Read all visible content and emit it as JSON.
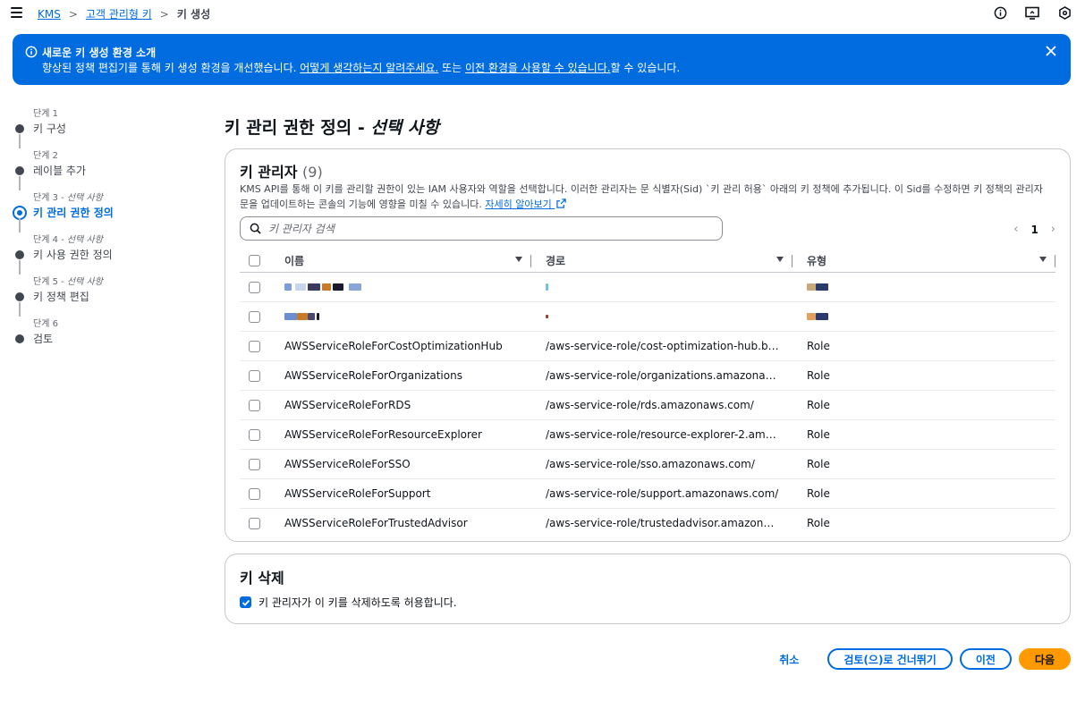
{
  "breadcrumb": {
    "items": [
      "KMS",
      "고객 관리형 키"
    ],
    "current": "키 생성"
  },
  "flash": {
    "title": "새로운 키 생성 환경 소개",
    "body_prefix": "향상된 정책 편집기를 통해 키 생성 환경을 개선했습니다. ",
    "link1": "어떻게 생각하는지 알려주세요.",
    "middle": " 또는 ",
    "link2": "이전 환경을 사용할 수 있습니다.",
    "suffix": "할 수 있습니다."
  },
  "steps": [
    {
      "small": "단계 1",
      "optional": "",
      "label": "키 구성",
      "active": false
    },
    {
      "small": "단계 2",
      "optional": "",
      "label": "레이블 추가",
      "active": false
    },
    {
      "small": "단계 3 - ",
      "optional": "선택 사항",
      "label": "키 관리 권한 정의",
      "active": true
    },
    {
      "small": "단계 4 - ",
      "optional": "선택 사항",
      "label": "키 사용 권한 정의",
      "active": false
    },
    {
      "small": "단계 5 - ",
      "optional": "선택 사항",
      "label": "키 정책 편집",
      "active": false
    },
    {
      "small": "단계 6",
      "optional": "",
      "label": "검토",
      "active": false
    }
  ],
  "page": {
    "title": "키 관리 권한 정의 - ",
    "title_optional": "선택 사항"
  },
  "admins": {
    "heading": "키 관리자",
    "count": "(9)",
    "desc": "KMS API를 통해 이 키를 관리할 권한이 있는 IAM 사용자와 역할을 선택합니다. 이러한 관리자는 문 식별자(Sid) `키 관리 허용` 아래의 키 정책에 추가됩니다. 이 Sid를 수정하면 키 정책의 관리자 문을 업데이트하는 콘솔의 기능에 영향을 미칠 수 있습니다. ",
    "learn_more": "자세히 알아보기",
    "search_placeholder": "키 관리자 검색",
    "page_number": "1",
    "columns": [
      "이름",
      "경로",
      "유형"
    ],
    "rows": [
      {
        "name": "",
        "path": "",
        "type": ""
      },
      {
        "name": "",
        "path": "",
        "type": ""
      },
      {
        "name": "AWSServiceRoleForCostOptimizationHub",
        "path": "/aws-service-role/cost-optimization-hub.bcm.…",
        "type": "Role"
      },
      {
        "name": "AWSServiceRoleForOrganizations",
        "path": "/aws-service-role/organizations.amazonaws.co…",
        "type": "Role"
      },
      {
        "name": "AWSServiceRoleForRDS",
        "path": "/aws-service-role/rds.amazonaws.com/",
        "type": "Role"
      },
      {
        "name": "AWSServiceRoleForResourceExplorer",
        "path": "/aws-service-role/resource-explorer-2.amazon…",
        "type": "Role"
      },
      {
        "name": "AWSServiceRoleForSSO",
        "path": "/aws-service-role/sso.amazonaws.com/",
        "type": "Role"
      },
      {
        "name": "AWSServiceRoleForSupport",
        "path": "/aws-service-role/support.amazonaws.com/",
        "type": "Role"
      },
      {
        "name": "AWSServiceRoleForTrustedAdvisor",
        "path": "/aws-service-role/trustedadvisor.amazonaws.c…",
        "type": "Role"
      }
    ]
  },
  "deletion": {
    "heading": "키 삭제",
    "allow_label": "키 관리자가 이 키를 삭제하도록 허용합니다.",
    "allow_checked": true
  },
  "actions": {
    "cancel": "취소",
    "skip": "검토(으)로 건너뛰기",
    "previous": "이전",
    "next": "다음"
  },
  "colors": {
    "accent": "#006ce0",
    "primary_button": "#ff9900"
  }
}
